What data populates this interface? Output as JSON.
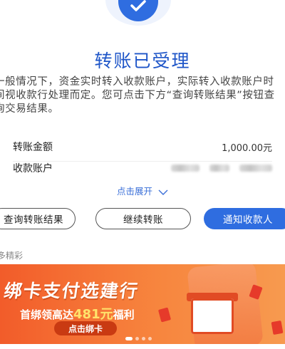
{
  "header": {
    "icon": "check-icon",
    "title": "转账已受理",
    "description": "一般情况下，资金实时转入收款账户，实际转入收款账户时间视收款行处理而定。您可点击下方“查询转账结果”按钮查询交易结果。"
  },
  "details": {
    "amount_label": "转账金额",
    "amount_value": "1,000.00元",
    "account_label": "收款账户"
  },
  "expand_label": "点击展开",
  "buttons": {
    "query": "查询转账结果",
    "continue": "继续转账",
    "notify": "通知收款人"
  },
  "more_label": "多精彩",
  "banner": {
    "title": "绑卡支付选建行",
    "subtitle_prefix": "首绑领高达",
    "subtitle_amount": "481元",
    "subtitle_suffix": "福利",
    "cta": "点击绑卡"
  },
  "colors": {
    "accent": "#2f6de0",
    "title": "#1f56c8",
    "banner": "#f25c2a"
  }
}
